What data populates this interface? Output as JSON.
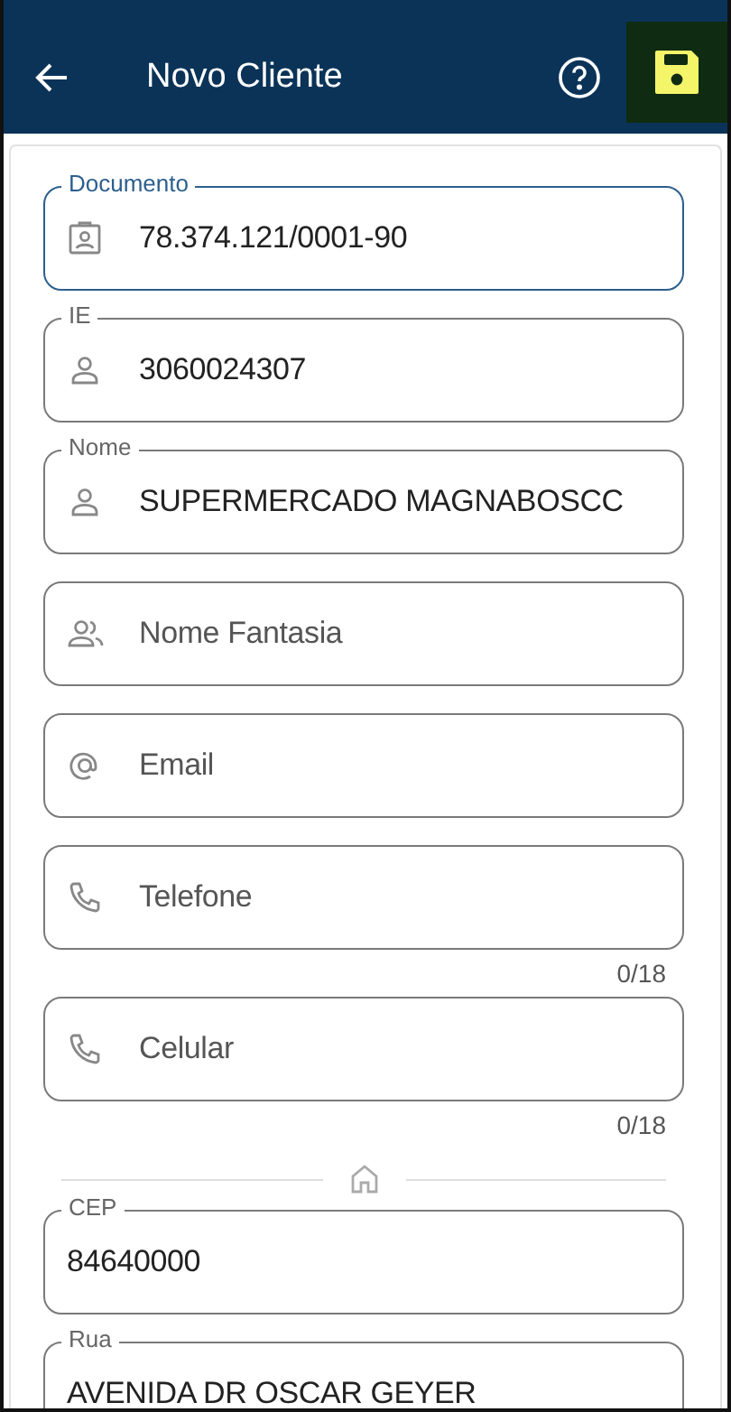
{
  "header": {
    "title": "Novo Cliente"
  },
  "fields": [
    {
      "kind": "document",
      "label": "Documento",
      "value": "78.374.121/0001-90",
      "focused": true
    },
    {
      "kind": "person",
      "label": "IE",
      "value": "3060024307",
      "focused": false
    },
    {
      "kind": "person",
      "label": "Nome",
      "value": "SUPERMERCADO MAGNABOSCC",
      "focused": false
    },
    {
      "kind": "people",
      "placeholder": "Nome Fantasia",
      "focused": false
    },
    {
      "kind": "email",
      "placeholder": "Email",
      "focused": false
    },
    {
      "kind": "phone",
      "placeholder": "Telefone",
      "counter": "0/18",
      "focused": false
    },
    {
      "kind": "phone",
      "placeholder": "Celular",
      "counter": "0/18",
      "focused": false
    },
    {
      "kind": "divider"
    },
    {
      "kind": "plain",
      "label": "CEP",
      "value": "84640000",
      "focused": false
    },
    {
      "kind": "plain",
      "label": "Rua",
      "value": "AVENIDA DR OSCAR GEYER",
      "focused": false
    }
  ]
}
